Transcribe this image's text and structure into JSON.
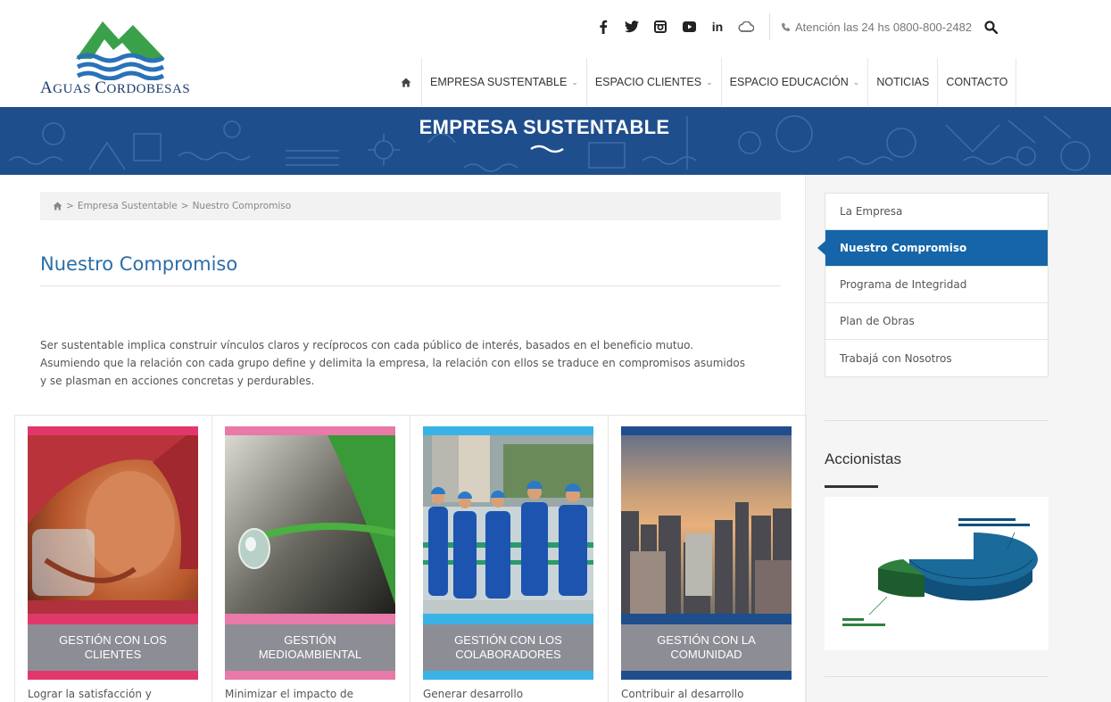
{
  "logo": {
    "name": "Aguas Cordobesas"
  },
  "topbar": {
    "social": [
      "facebook-icon",
      "twitter-icon",
      "instagram-icon",
      "youtube-icon",
      "linkedin-icon",
      "cloud-icon"
    ],
    "linkedin_text": "in",
    "attention": "Atención las 24 hs 0800-800-2482"
  },
  "nav": {
    "items": [
      {
        "label": "",
        "icon": "home-icon"
      },
      {
        "label": "EMPRESA SUSTENTABLE",
        "dropdown": true
      },
      {
        "label": "ESPACIO CLIENTES",
        "dropdown": true
      },
      {
        "label": "ESPACIO EDUCACIÓN",
        "dropdown": true
      },
      {
        "label": "NOTICIAS",
        "dropdown": false
      },
      {
        "label": "CONTACTO",
        "dropdown": false
      }
    ]
  },
  "banner": {
    "title": "EMPRESA SUSTENTABLE"
  },
  "breadcrumb": {
    "sep": ">",
    "items": [
      "Empresa Sustentable",
      "Nuestro Compromiso"
    ]
  },
  "page": {
    "title": "Nuestro Compromiso",
    "intro": "Ser sustentable implica construir vínculos claros y recíprocos con cada público de interés, basados en el beneficio mutuo. Asumiendo que la relación con cada grupo define y delimita la empresa, la relación con ellos se traduce en compromisos asumidos y se plasman en acciones concretas y perdurables."
  },
  "cards": [
    {
      "label": "GESTIÓN CON LOS CLIENTES",
      "desc": "Lograr la satisfacción y",
      "accent": "#e0386a"
    },
    {
      "label": "GESTIÓN MEDIOAMBIENTAL",
      "desc": "Minimizar el impacto de",
      "accent": "#e879a8"
    },
    {
      "label": "GESTIÓN CON LOS COLABORADORES",
      "desc": "Generar desarrollo",
      "accent": "#39b3e6"
    },
    {
      "label": "GESTIÓN CON LA COMUNIDAD",
      "desc": "Contribuir al desarrollo",
      "accent": "#1f4e8c"
    }
  ],
  "sidebar": {
    "menu": [
      {
        "label": "La Empresa",
        "active": false
      },
      {
        "label": "Nuestro Compromiso",
        "active": true
      },
      {
        "label": "Programa de Integridad",
        "active": false
      },
      {
        "label": "Plan de Obras",
        "active": false
      },
      {
        "label": "Trabajá con Nosotros",
        "active": false
      }
    ],
    "shareholders_title": "Accionistas"
  },
  "colors": {
    "brand_blue": "#1f4e8c",
    "title_blue": "#2a6ea8",
    "active_menu": "#1565a8",
    "label_gray": "#8d8e95"
  }
}
